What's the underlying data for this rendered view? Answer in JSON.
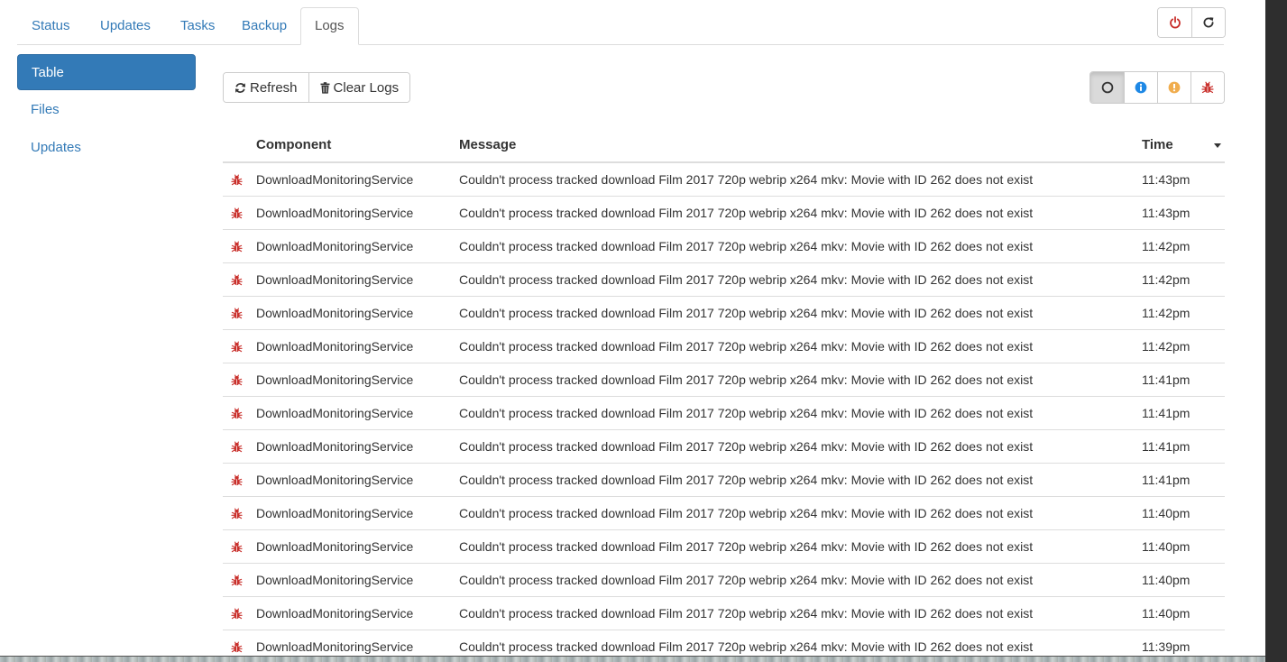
{
  "tabs": [
    {
      "label": "Status"
    },
    {
      "label": "Updates"
    },
    {
      "label": "Tasks"
    },
    {
      "label": "Backup"
    },
    {
      "label": "Logs",
      "active": true
    }
  ],
  "system_buttons": {
    "shutdown_icon": "power-icon",
    "restart_icon": "restart-icon"
  },
  "sidebar": {
    "items": [
      {
        "label": "Table",
        "active": true
      },
      {
        "label": "Files"
      },
      {
        "label": "Updates"
      }
    ]
  },
  "toolbar": {
    "refresh_label": "Refresh",
    "clear_label": "Clear Logs",
    "filters": [
      {
        "icon": "circle-outline-icon",
        "level": "all",
        "active": true
      },
      {
        "icon": "info-icon",
        "level": "info"
      },
      {
        "icon": "warning-icon",
        "level": "warn"
      },
      {
        "icon": "bug-icon",
        "level": "error"
      }
    ]
  },
  "colors": {
    "accent": "#337ab7",
    "error": "#c9302c",
    "info": "#1e88e5",
    "warn": "#f0ad4e"
  },
  "table": {
    "columns": {
      "component": "Component",
      "message": "Message",
      "time": "Time"
    },
    "rows": [
      {
        "level": "error",
        "component": "DownloadMonitoringService",
        "message": "Couldn't process tracked download Film 2017 720p webrip x264 mkv: Movie with ID 262 does not exist",
        "time": "11:43pm"
      },
      {
        "level": "error",
        "component": "DownloadMonitoringService",
        "message": "Couldn't process tracked download Film 2017 720p webrip x264 mkv: Movie with ID 262 does not exist",
        "time": "11:43pm"
      },
      {
        "level": "error",
        "component": "DownloadMonitoringService",
        "message": "Couldn't process tracked download Film 2017 720p webrip x264 mkv: Movie with ID 262 does not exist",
        "time": "11:42pm"
      },
      {
        "level": "error",
        "component": "DownloadMonitoringService",
        "message": "Couldn't process tracked download Film 2017 720p webrip x264 mkv: Movie with ID 262 does not exist",
        "time": "11:42pm"
      },
      {
        "level": "error",
        "component": "DownloadMonitoringService",
        "message": "Couldn't process tracked download Film 2017 720p webrip x264 mkv: Movie with ID 262 does not exist",
        "time": "11:42pm"
      },
      {
        "level": "error",
        "component": "DownloadMonitoringService",
        "message": "Couldn't process tracked download Film 2017 720p webrip x264 mkv: Movie with ID 262 does not exist",
        "time": "11:42pm"
      },
      {
        "level": "error",
        "component": "DownloadMonitoringService",
        "message": "Couldn't process tracked download Film 2017 720p webrip x264 mkv: Movie with ID 262 does not exist",
        "time": "11:41pm"
      },
      {
        "level": "error",
        "component": "DownloadMonitoringService",
        "message": "Couldn't process tracked download Film 2017 720p webrip x264 mkv: Movie with ID 262 does not exist",
        "time": "11:41pm"
      },
      {
        "level": "error",
        "component": "DownloadMonitoringService",
        "message": "Couldn't process tracked download Film 2017 720p webrip x264 mkv: Movie with ID 262 does not exist",
        "time": "11:41pm"
      },
      {
        "level": "error",
        "component": "DownloadMonitoringService",
        "message": "Couldn't process tracked download Film 2017 720p webrip x264 mkv: Movie with ID 262 does not exist",
        "time": "11:41pm"
      },
      {
        "level": "error",
        "component": "DownloadMonitoringService",
        "message": "Couldn't process tracked download Film 2017 720p webrip x264 mkv: Movie with ID 262 does not exist",
        "time": "11:40pm"
      },
      {
        "level": "error",
        "component": "DownloadMonitoringService",
        "message": "Couldn't process tracked download Film 2017 720p webrip x264 mkv: Movie with ID 262 does not exist",
        "time": "11:40pm"
      },
      {
        "level": "error",
        "component": "DownloadMonitoringService",
        "message": "Couldn't process tracked download Film 2017 720p webrip x264 mkv: Movie with ID 262 does not exist",
        "time": "11:40pm"
      },
      {
        "level": "error",
        "component": "DownloadMonitoringService",
        "message": "Couldn't process tracked download Film 2017 720p webrip x264 mkv: Movie with ID 262 does not exist",
        "time": "11:40pm"
      },
      {
        "level": "error",
        "component": "DownloadMonitoringService",
        "message": "Couldn't process tracked download Film 2017 720p webrip x264 mkv: Movie with ID 262 does not exist",
        "time": "11:39pm"
      }
    ]
  }
}
